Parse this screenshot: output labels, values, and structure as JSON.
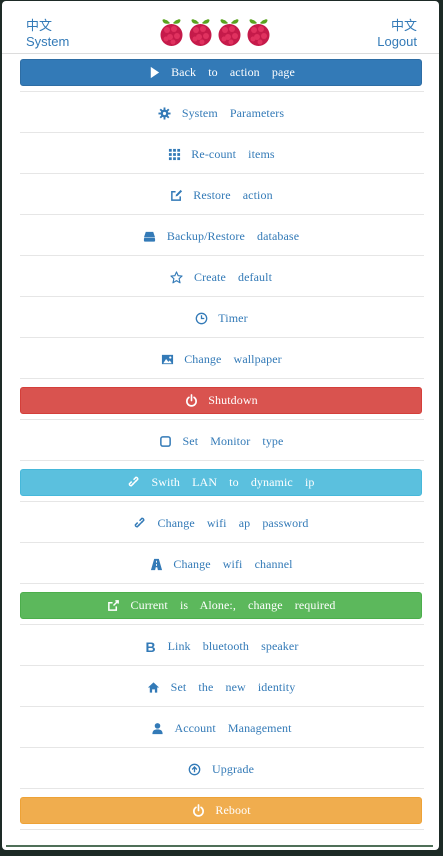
{
  "header": {
    "left_lang": "中文",
    "left_label": "System",
    "right_lang": "中文",
    "right_label": "Logout",
    "logo_icons": [
      "raspberry-icon",
      "raspberry-icon",
      "raspberry-icon",
      "raspberry-icon"
    ]
  },
  "menu": [
    {
      "label": "Back to action page",
      "icon": "play-icon",
      "style": "primary"
    },
    {
      "label": "System Parameters",
      "icon": "gear-icon",
      "style": "link"
    },
    {
      "label": "Re-count items",
      "icon": "grid-icon",
      "style": "link"
    },
    {
      "label": "Restore action",
      "icon": "edit-icon",
      "style": "link"
    },
    {
      "label": "Backup/Restore database",
      "icon": "hdd-icon",
      "style": "link"
    },
    {
      "label": "Create default",
      "icon": "star-icon",
      "style": "link"
    },
    {
      "label": "Timer",
      "icon": "clock-icon",
      "style": "link"
    },
    {
      "label": "Change wallpaper",
      "icon": "picture-icon",
      "style": "link"
    },
    {
      "label": "Shutdown",
      "icon": "power-icon",
      "style": "danger"
    },
    {
      "label": "Set Monitor type",
      "icon": "stop-icon",
      "style": "link"
    },
    {
      "label": "Swith LAN to dynamic ip",
      "icon": "link-icon",
      "style": "info"
    },
    {
      "label": "Change wifi ap password",
      "icon": "link-icon",
      "style": "link"
    },
    {
      "label": "Change wifi channel",
      "icon": "road-icon",
      "style": "link"
    },
    {
      "label": "Current is Alone:, change required",
      "icon": "share-icon",
      "style": "success"
    },
    {
      "label": "Link bluetooth speaker",
      "icon": "bluetooth-icon",
      "style": "link"
    },
    {
      "label": "Set the new identity",
      "icon": "home-icon",
      "style": "link"
    },
    {
      "label": "Account Management",
      "icon": "user-icon",
      "style": "link"
    },
    {
      "label": "Upgrade",
      "icon": "upload-icon",
      "style": "link"
    },
    {
      "label": "Reboot",
      "icon": "power-icon",
      "style": "warning"
    }
  ]
}
